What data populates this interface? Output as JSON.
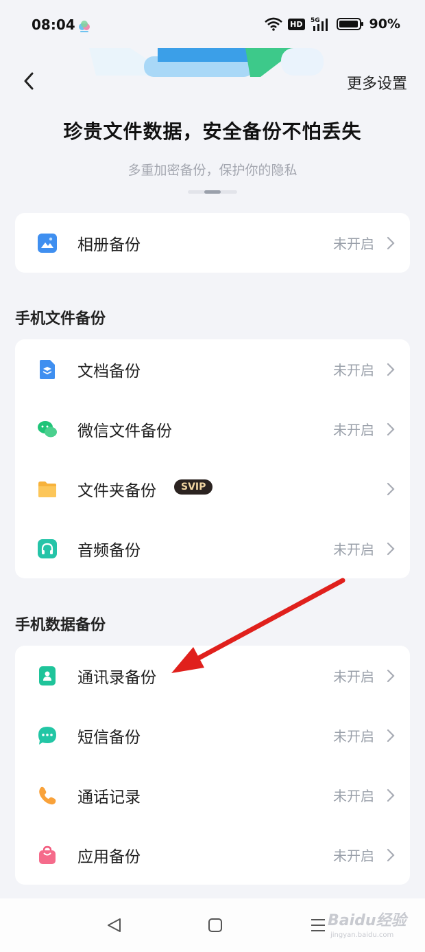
{
  "status_bar": {
    "time": "08:04",
    "battery_pct": "90%",
    "hd_badge": "HD",
    "network": "5G"
  },
  "header": {
    "back_icon": "chevron-left-icon",
    "more_settings": "更多设置"
  },
  "hero": {
    "headline": "珍贵文件数据，安全备份不怕丢失",
    "subline": "多重加密备份，保护你的隐私"
  },
  "photo_card": {
    "items": [
      {
        "label": "相册备份",
        "status": "未开启",
        "icon": "photo-icon"
      }
    ]
  },
  "file_section": {
    "title": "手机文件备份",
    "items": [
      {
        "label": "文档备份",
        "status": "未开启",
        "icon": "document-icon"
      },
      {
        "label": "微信文件备份",
        "status": "未开启",
        "icon": "wechat-icon"
      },
      {
        "label": "文件夹备份",
        "badge": "SVIP",
        "icon": "folder-icon"
      },
      {
        "label": "音频备份",
        "status": "未开启",
        "icon": "headphones-icon"
      }
    ]
  },
  "data_section": {
    "title": "手机数据备份",
    "items": [
      {
        "label": "通讯录备份",
        "status": "未开启",
        "icon": "contacts-icon"
      },
      {
        "label": "短信备份",
        "status": "未开启",
        "icon": "message-icon"
      },
      {
        "label": "通话记录",
        "status": "未开启",
        "icon": "phone-icon"
      },
      {
        "label": "应用备份",
        "status": "未开启",
        "icon": "app-bag-icon"
      }
    ]
  },
  "watermark": {
    "brand": "Baidu经验",
    "url": "jingyan.baidu.com"
  },
  "colors": {
    "background": "#f3f4f8",
    "card": "#ffffff",
    "status_text": "#9aa0aa",
    "annotation_arrow": "#e0201c"
  }
}
